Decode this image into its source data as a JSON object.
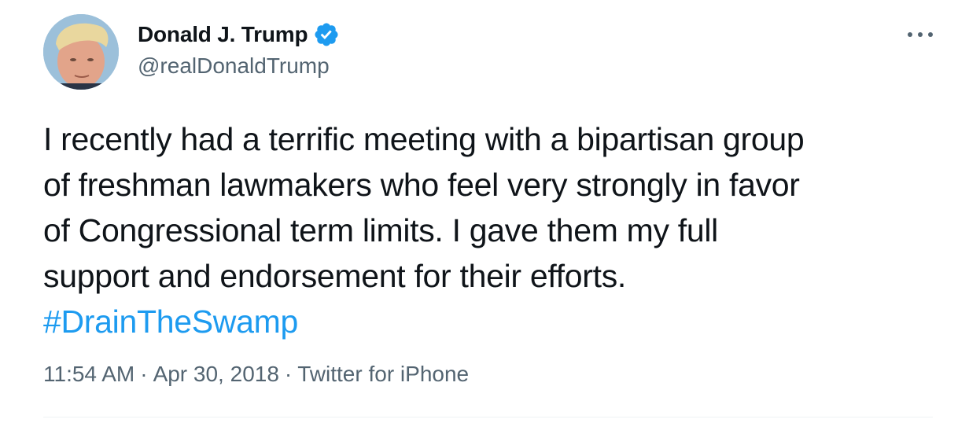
{
  "tweet": {
    "author": {
      "display_name": "Donald J. Trump",
      "handle": "@realDonaldTrump",
      "verified": true,
      "avatar": "profile-photo"
    },
    "more_icon": "more-horizontal-icon",
    "body_lines": [
      "I recently had a terrific meeting with a bipartisan group",
      "of freshman lawmakers who feel very strongly in favor",
      "of Congressional term limits. I gave them my full",
      "support and endorsement for their efforts."
    ],
    "hashtag": "#DrainTheSwamp",
    "time": "11:54 AM",
    "separator": "·",
    "date": "Apr 30, 2018",
    "source": "Twitter for iPhone"
  },
  "colors": {
    "text": "#0f1419",
    "secondary": "#536471",
    "link": "#1d9bf0",
    "verified": "#1d9bf0",
    "divider": "#eff3f4"
  }
}
